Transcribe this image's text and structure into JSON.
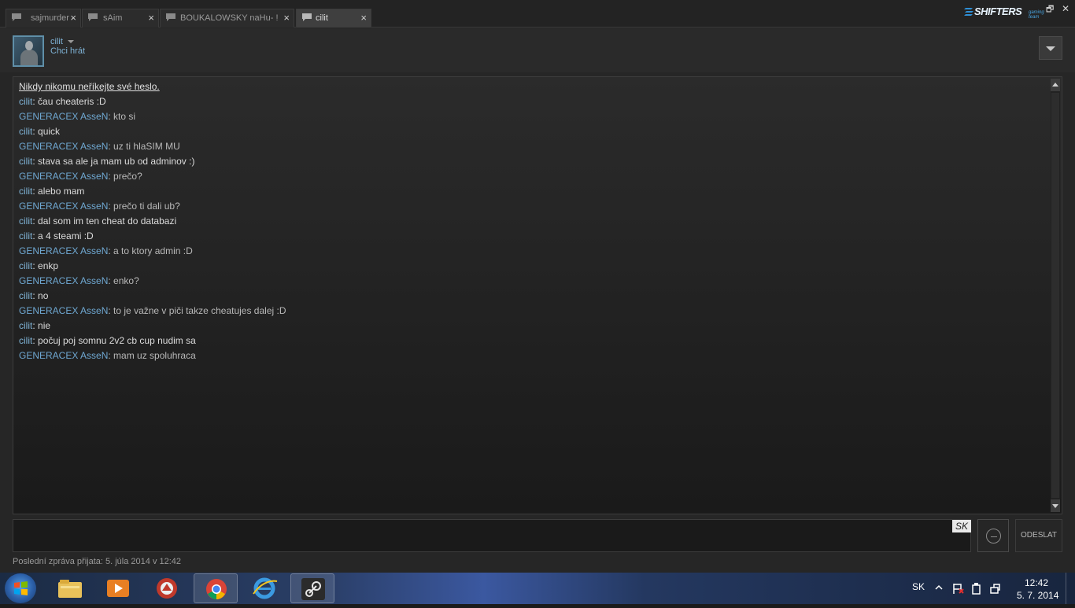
{
  "window": {
    "tabs": [
      {
        "label": "sajmurder",
        "close": "×"
      },
      {
        "label": "sAim",
        "close": "×"
      },
      {
        "label": "BOUKALOWSKY naHu- !",
        "close": "×"
      },
      {
        "label": "cilit",
        "close": "×"
      }
    ],
    "brand": {
      "name": "SHIFTERS",
      "sub": "gaming team"
    },
    "controls": {
      "restore": "🗗",
      "close": "✕"
    }
  },
  "header": {
    "username": "cilit",
    "status": "Chci hrát"
  },
  "chat": {
    "warning": "Nikdy nikomu neříkejte své heslo.",
    "messages": [
      {
        "sender": "cilit",
        "text": "čau cheateris :D"
      },
      {
        "sender": "GENERACEX AsseN",
        "text": "kto si"
      },
      {
        "sender": "cilit",
        "text": "quick"
      },
      {
        "sender": "GENERACEX AsseN",
        "text": "uz ti hlaSIM MU"
      },
      {
        "sender": "cilit",
        "text": "stava sa ale ja mam ub od adminov :)"
      },
      {
        "sender": "GENERACEX AsseN",
        "text": "prečo?"
      },
      {
        "sender": "cilit",
        "text": "alebo mam"
      },
      {
        "sender": "GENERACEX AsseN",
        "text": "prečo ti dali ub?"
      },
      {
        "sender": "cilit",
        "text": "dal som im ten cheat do databazi"
      },
      {
        "sender": "cilit",
        "text": "a 4 steami :D"
      },
      {
        "sender": "GENERACEX AsseN",
        "text": "a to ktory admin :D"
      },
      {
        "sender": "cilit",
        "text": "enkp"
      },
      {
        "sender": "GENERACEX AsseN",
        "text": "enko?"
      },
      {
        "sender": "cilit",
        "text": "no"
      },
      {
        "sender": "GENERACEX AsseN",
        "text": "to je važne v piči takze cheatujes dalej :D"
      },
      {
        "sender": "cilit",
        "text": "nie"
      },
      {
        "sender": "cilit",
        "text": "počuj poj somnu 2v2 cb cup nudim sa"
      },
      {
        "sender": "GENERACEX AsseN",
        "text": "mam uz spoluhraca"
      }
    ]
  },
  "composer": {
    "value": "",
    "language": "SK",
    "send_label": "ODESLAT"
  },
  "footer": {
    "last_message": "Poslední zpráva přijata: 5. júla 2014 v 12:42"
  },
  "taskbar": {
    "apps": [
      "explorer-icon",
      "media-player-icon",
      "game-app-icon",
      "chrome-icon",
      "internet-explorer-icon",
      "steam-icon"
    ],
    "language": "SK",
    "time": "12:42",
    "date": "5. 7. 2014"
  },
  "colors": {
    "accent": "#7fb3d6",
    "background": "#262626",
    "text": "#dcdcdc"
  }
}
